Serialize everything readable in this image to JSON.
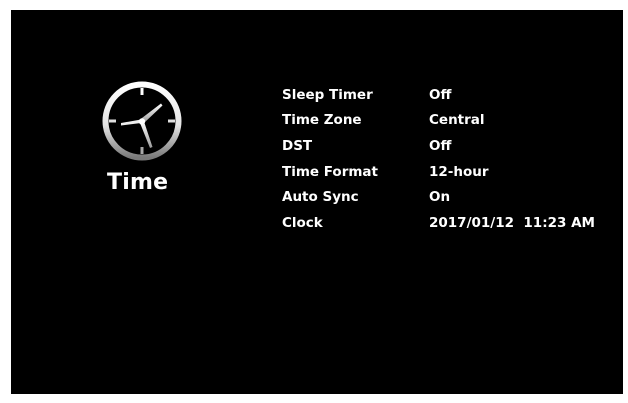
{
  "menu": {
    "title": "Time",
    "icon": "clock-icon"
  },
  "colors": {
    "background": "#000000",
    "text": "#ffffff",
    "frame": "#ffffff"
  },
  "settings": [
    {
      "label": "Sleep Timer",
      "value": "Off"
    },
    {
      "label": "Time Zone",
      "value": "Central"
    },
    {
      "label": "DST",
      "value": "Off"
    },
    {
      "label": "Time Format",
      "value": "12-hour"
    },
    {
      "label": "Auto Sync",
      "value": "On"
    },
    {
      "label": "Clock",
      "value": "2017/01/12  11:23 AM"
    }
  ]
}
